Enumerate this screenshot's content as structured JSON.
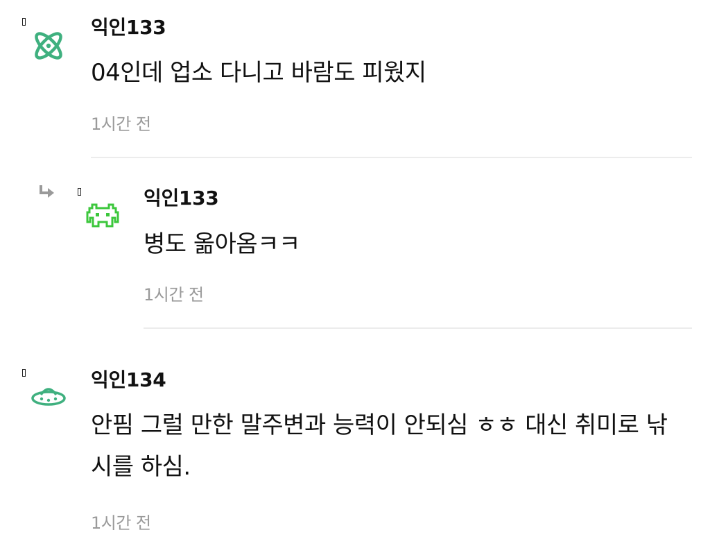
{
  "comments": [
    {
      "nickname": "익인133",
      "text": "04인데 업소 다니고 바람도 피웠지",
      "time": "1시간 전",
      "avatar": "atom-icon",
      "avatar_color": "#3fb07f",
      "is_reply": false
    },
    {
      "nickname": "익인133",
      "text": "병도 옮아옴ㅋㅋ",
      "time": "1시간 전",
      "avatar": "space-invader-icon",
      "avatar_color": "#3cc73c",
      "is_reply": true
    },
    {
      "nickname": "익인134",
      "text": "안핌 그럴 만한 말주변과 능력이 안되심 ㅎㅎ 대신 취미로 낚시를 하심.",
      "time": "1시간 전",
      "avatar": "ufo-icon",
      "avatar_color": "#3fb07f",
      "is_reply": false
    }
  ]
}
